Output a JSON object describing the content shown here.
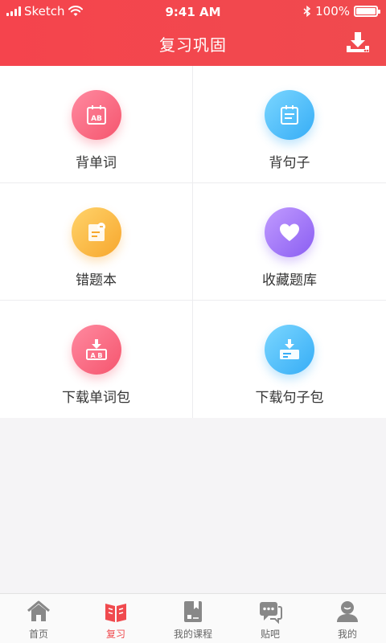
{
  "status_bar": {
    "carrier": "Sketch",
    "time": "9:41 AM",
    "battery": "100%"
  },
  "header": {
    "title": "复习巩固",
    "download_icon": "download-icon"
  },
  "grid_items": [
    {
      "label": "背单词",
      "icon": "ab-card-icon",
      "color": "#f5556e"
    },
    {
      "label": "背句子",
      "icon": "sentence-card-icon",
      "color": "#36adf6"
    },
    {
      "label": "错题本",
      "icon": "notebook-icon",
      "color": "#f7a72d"
    },
    {
      "label": "收藏题库",
      "icon": "heart-icon",
      "color": "#8a5ef2"
    },
    {
      "label": "下载单词包",
      "icon": "download-words-icon",
      "color": "#f5556e"
    },
    {
      "label": "下载句子包",
      "icon": "download-sentences-icon",
      "color": "#36adf6"
    }
  ],
  "tabbar": {
    "active_color": "#f04a4e",
    "items": [
      {
        "label": "首页",
        "icon": "home-icon"
      },
      {
        "label": "复习",
        "icon": "review-book-icon"
      },
      {
        "label": "我的课程",
        "icon": "course-icon"
      },
      {
        "label": "贴吧",
        "icon": "chat-icon"
      },
      {
        "label": "我的",
        "icon": "profile-icon"
      }
    ]
  }
}
